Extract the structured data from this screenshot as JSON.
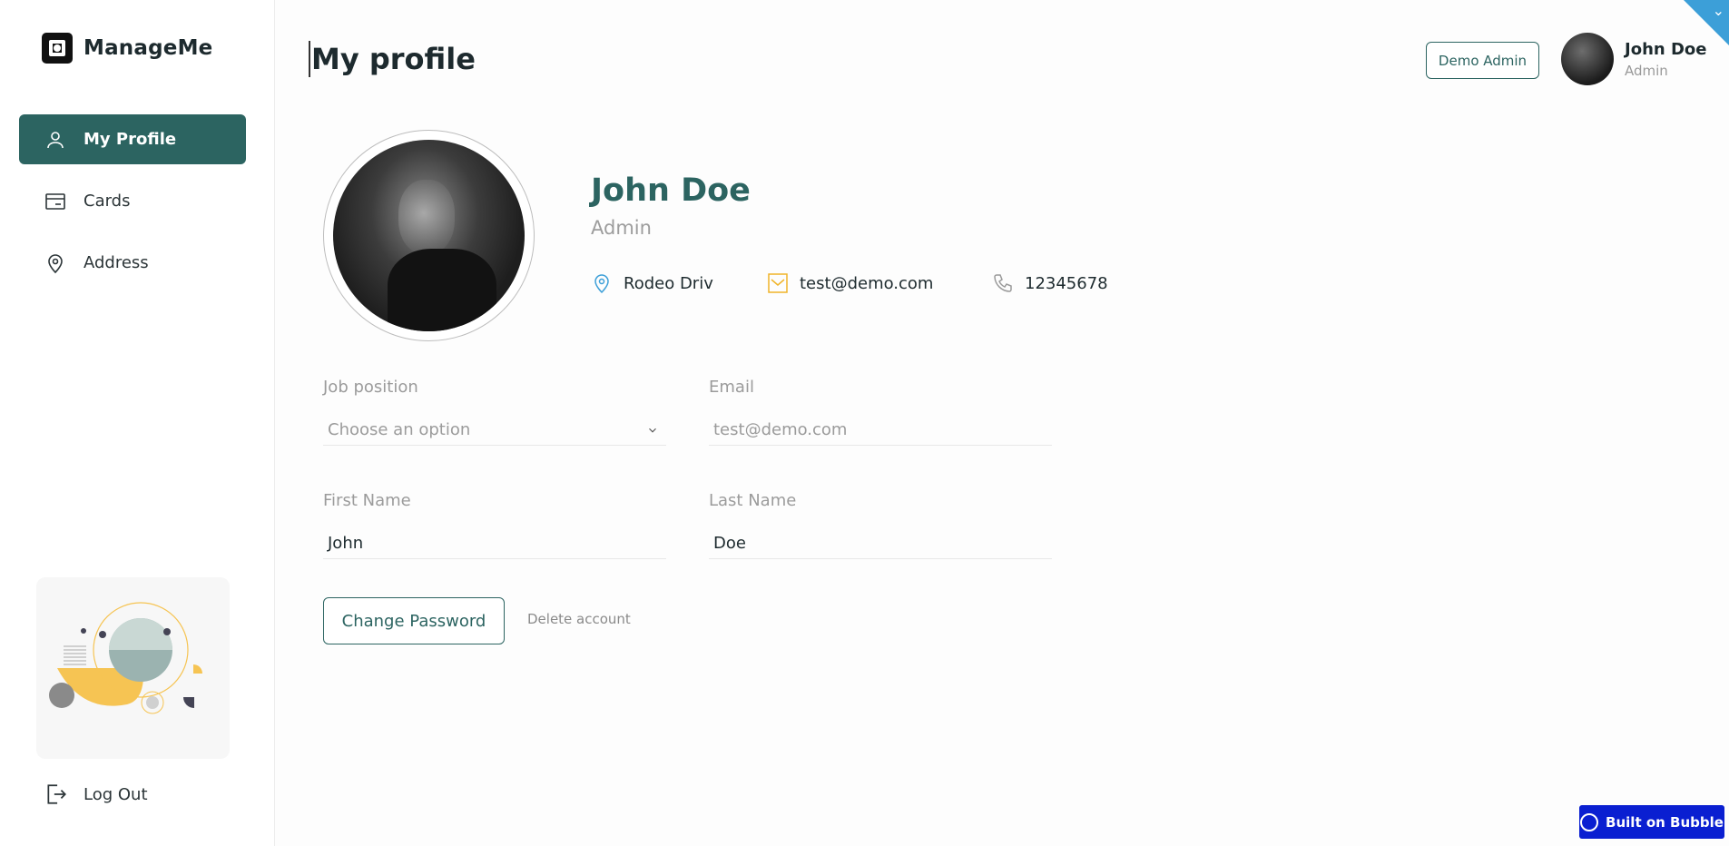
{
  "brand": {
    "name": "ManageMe"
  },
  "sidebar": {
    "items": [
      {
        "label": "My Profile",
        "icon": "user-icon",
        "active": true
      },
      {
        "label": "Cards",
        "icon": "card-icon",
        "active": false
      },
      {
        "label": "Address",
        "icon": "map-pin-icon",
        "active": false
      }
    ],
    "logout_label": "Log Out"
  },
  "header": {
    "title": "My profile",
    "demo_button": "Demo Admin",
    "user_name": "John Doe",
    "user_role": "Admin"
  },
  "profile": {
    "name": "John Doe",
    "role": "Admin",
    "location": "Rodeo Driv",
    "email": "test@demo.com",
    "phone": "12345678"
  },
  "form": {
    "job_position": {
      "label": "Job position",
      "placeholder": "Choose an option"
    },
    "email": {
      "label": "Email",
      "placeholder": "test@demo.com"
    },
    "first_name": {
      "label": "First Name",
      "value": "John"
    },
    "last_name": {
      "label": "Last Name",
      "value": "Doe"
    },
    "change_password": "Change Password",
    "delete_account": "Delete account"
  },
  "footer": {
    "bubble_label": "Built on Bubble"
  },
  "colors": {
    "accent": "#2c6461",
    "bubble": "#0a1fd1",
    "corner": "#3c9fd8",
    "location_icon": "#3c9fd8",
    "email_icon": "#f0b429"
  }
}
